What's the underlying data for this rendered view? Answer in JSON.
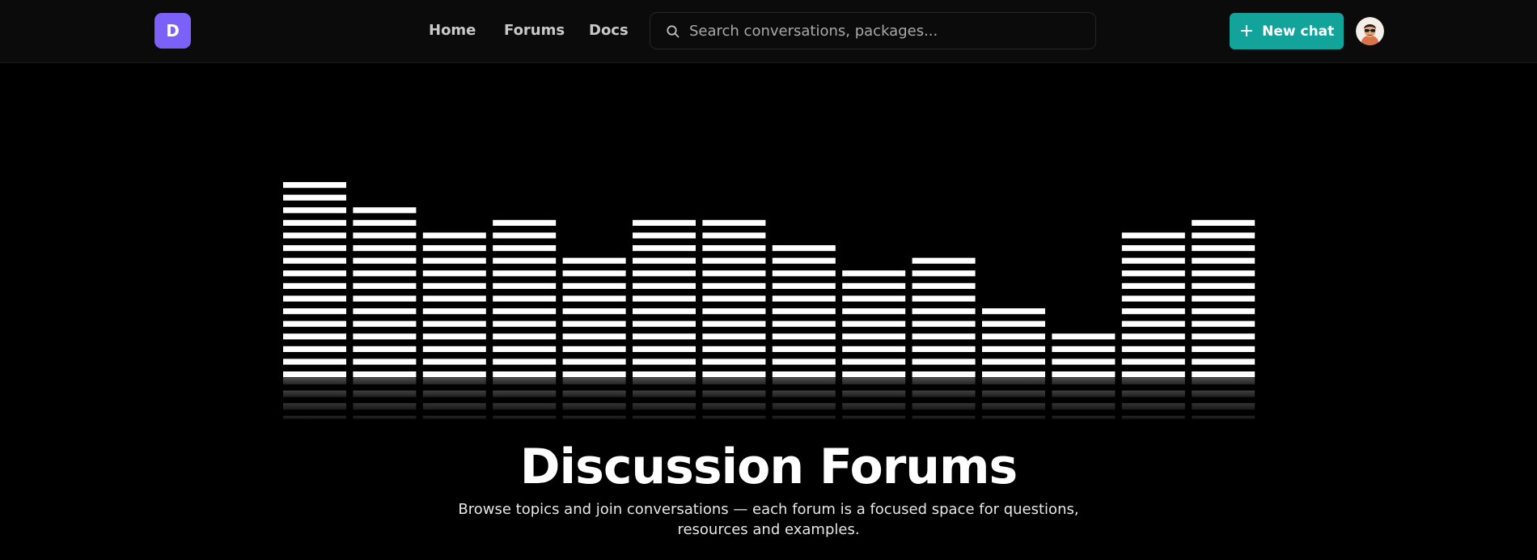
{
  "header": {
    "logo_letter": "D",
    "nav": [
      "Home",
      "Forums",
      "Docs"
    ],
    "search_placeholder": "Search conversations, packages...",
    "new_chat_label": "New chat"
  },
  "hero": {
    "title": "Discussion Forums",
    "subtitle": "Browse topics and join conversations — each forum is a focused space for questions, resources and examples.",
    "equalizer_levels": [
      16,
      14,
      12,
      13,
      10,
      13,
      13,
      11,
      9,
      10,
      6,
      4,
      12,
      13
    ]
  },
  "colors": {
    "brand": "#7b61f8",
    "accent": "#12a39a",
    "background": "#000000"
  },
  "icons": {
    "search": "search-icon",
    "plus": "plus-icon"
  }
}
